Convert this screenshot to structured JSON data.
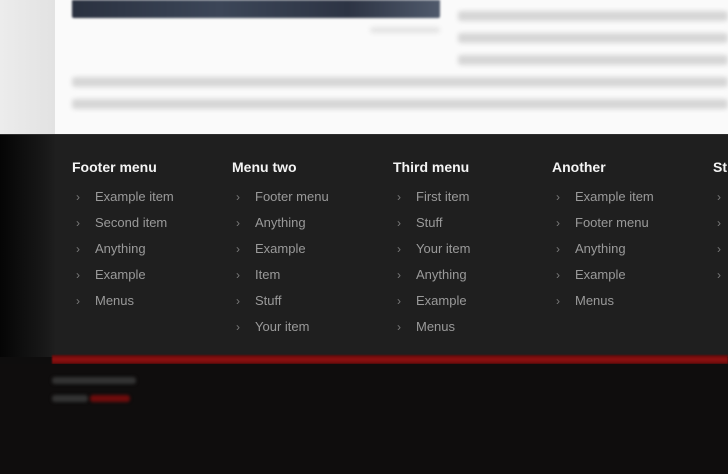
{
  "footer": {
    "columns": [
      {
        "title": "Footer menu",
        "items": [
          "Example item",
          "Second item",
          "Anything",
          "Example",
          "Menus"
        ]
      },
      {
        "title": "Menu two",
        "items": [
          "Footer menu",
          "Anything",
          "Example",
          "Item",
          "Stuff",
          "Your item"
        ]
      },
      {
        "title": "Third menu",
        "items": [
          "First item",
          "Stuff",
          "Your item",
          "Anything",
          "Example",
          "Menus"
        ]
      },
      {
        "title": "Another",
        "items": [
          "Example item",
          "Footer menu",
          "Anything",
          "Example",
          "Menus"
        ]
      },
      {
        "title": "St",
        "items": [
          "",
          "",
          "",
          ""
        ]
      }
    ]
  },
  "colors": {
    "footer_bg": "#1f1f1f",
    "accent_red": "#8e1010",
    "page_bg": "#0e0d0d"
  },
  "icons": {
    "menu_chevron": "chevron-right-icon"
  }
}
